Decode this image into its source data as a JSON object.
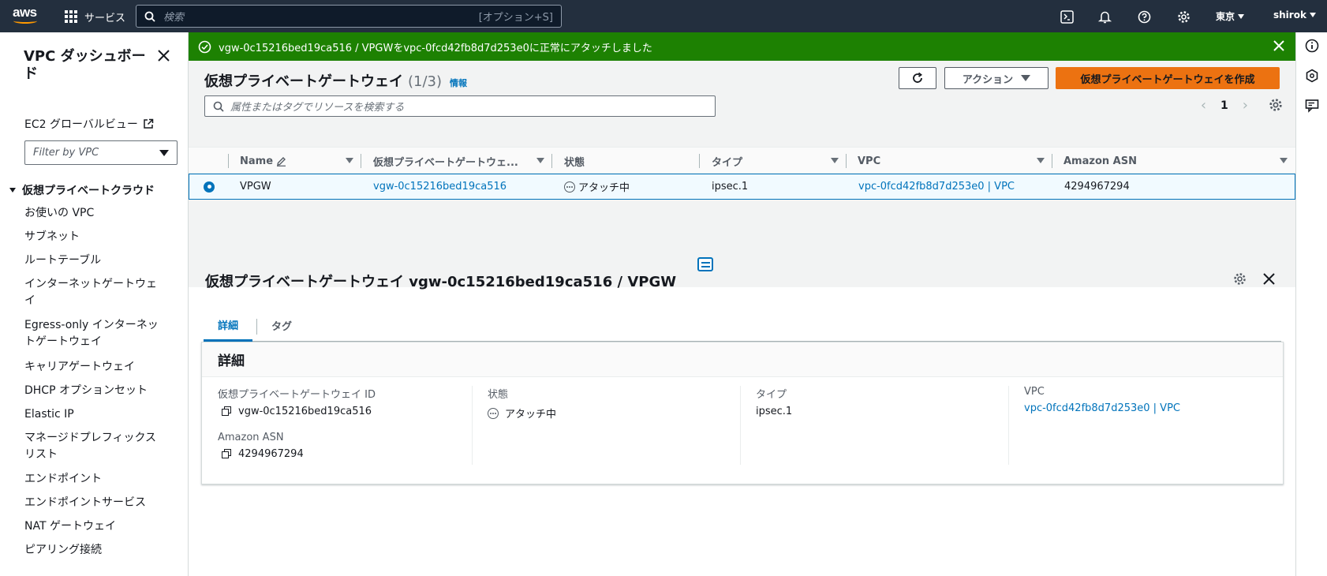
{
  "topnav": {
    "logo": "aws",
    "services_label": "サービス",
    "search_placeholder": "検索",
    "search_shortcut": "[オプション+S]",
    "region": "東京",
    "user": "shirok",
    "icons": [
      "cloudshell-icon",
      "bell-icon",
      "help-icon",
      "gear-icon"
    ]
  },
  "sidebar": {
    "title": "VPC ダッシュボード",
    "ec2_global_view": "EC2 グローバルビュー",
    "filter_placeholder": "Filter by VPC",
    "section": "仮想プライベートクラウド",
    "items": [
      {
        "label": "お使いの VPC"
      },
      {
        "label": "サブネット"
      },
      {
        "label": "ルートテーブル"
      },
      {
        "label": "インターネットゲートウェイ"
      },
      {
        "label": "Egress-only インターネットゲートウェイ"
      },
      {
        "label": "キャリアゲートウェイ"
      },
      {
        "label": "DHCP オプションセット"
      },
      {
        "label": "Elastic IP"
      },
      {
        "label": "マネージドプレフィックスリスト"
      },
      {
        "label": "エンドポイント"
      },
      {
        "label": "エンドポイントサービス"
      },
      {
        "label": "NAT ゲートウェイ"
      },
      {
        "label": "ピアリング接続"
      }
    ]
  },
  "flash": {
    "message": "vgw-0c15216bed19ca516 / VPGWをvpc-0fcd42fb8d7d253e0に正常にアタッチしました",
    "color": "#1d8102"
  },
  "list": {
    "title": "仮想プライベートゲートウェイ",
    "count": "(1/3)",
    "info": "情報",
    "actions_label": "アクション",
    "create_label": "仮想プライベートゲートウェイを作成",
    "search_placeholder": "属性またはタグでリソースを検索する",
    "page": "1",
    "columns": [
      "Name",
      "仮想プライベートゲートウェ...",
      "状態",
      "タイプ",
      "VPC",
      "Amazon ASN"
    ],
    "rows": [
      {
        "name": "VPGW",
        "id": "vgw-0c15216bed19ca516",
        "state": "アタッチ中",
        "type": "ipsec.1",
        "vpc": "vpc-0fcd42fb8d7d253e0 | VPC",
        "asn": "4294967294",
        "selected": true
      }
    ]
  },
  "detail": {
    "title": "仮想プライベートゲートウェイ vgw-0c15216bed19ca516 / VPGW",
    "tabs": [
      {
        "label": "詳細",
        "active": true
      },
      {
        "label": "タグ",
        "active": false
      }
    ],
    "card_title": "詳細",
    "fields": {
      "id_label": "仮想プライベートゲートウェイ ID",
      "id_value": "vgw-0c15216bed19ca516",
      "asn_label": "Amazon ASN",
      "asn_value": "4294967294",
      "state_label": "状態",
      "state_value": "アタッチ中",
      "type_label": "タイプ",
      "type_value": "ipsec.1",
      "vpc_label": "VPC",
      "vpc_value": "vpc-0fcd42fb8d7d253e0 | VPC"
    }
  },
  "colors": {
    "nav": "#232f3e",
    "accent": "#0073bb",
    "primary_button": "#ec7211",
    "success": "#1d8102"
  }
}
